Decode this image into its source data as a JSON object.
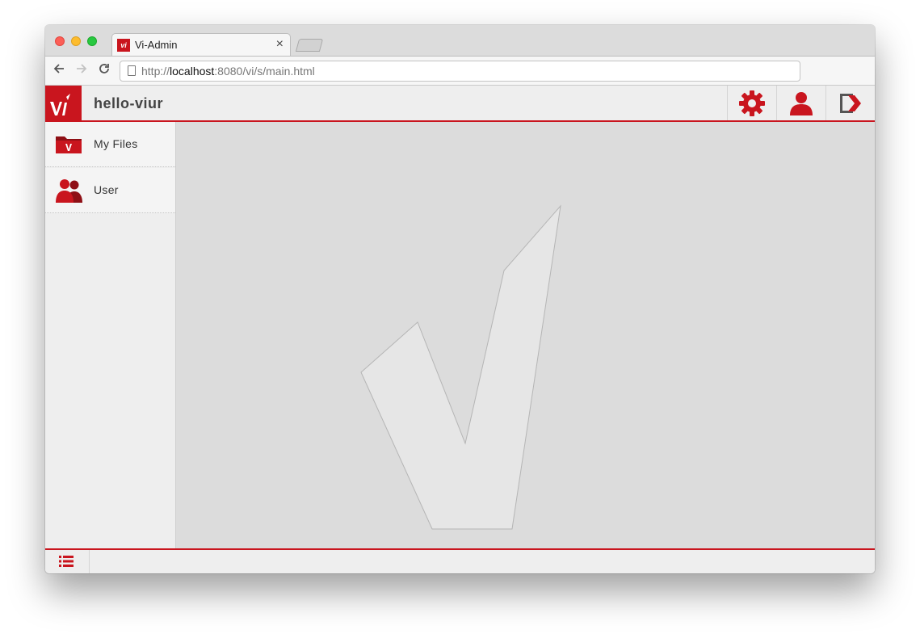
{
  "browser": {
    "tab_title": "Vi-Admin",
    "tab_favicon_text": "vi",
    "tab_close": "×",
    "url_scheme": "http://",
    "url_host": "localhost",
    "url_rest": ":8080/vi/s/main.html"
  },
  "app": {
    "title": "hello-viur",
    "brand_color": "#c9151e",
    "header_actions": [
      {
        "name": "settings",
        "icon": "gear-icon"
      },
      {
        "name": "user",
        "icon": "user-icon"
      },
      {
        "name": "logout",
        "icon": "logout-icon"
      }
    ]
  },
  "sidebar": {
    "items": [
      {
        "label": "My Files",
        "icon": "folder-icon"
      },
      {
        "label": "User",
        "icon": "users-icon"
      }
    ]
  },
  "main": {
    "watermark": "checkmark-icon"
  },
  "footer": {
    "icon": "list-icon"
  }
}
